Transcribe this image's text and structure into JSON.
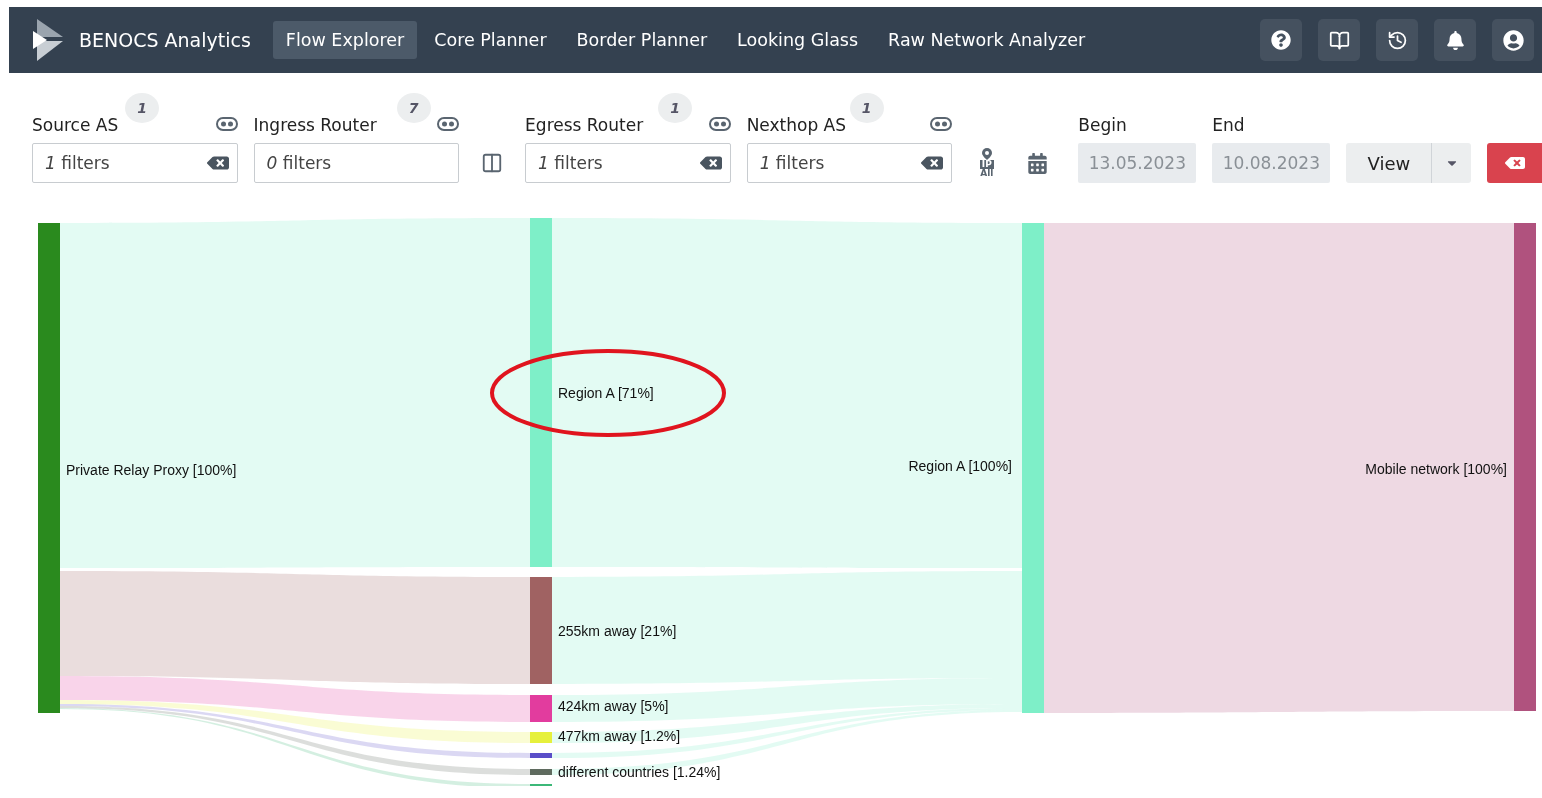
{
  "app": {
    "brand": "BENOCS Analytics"
  },
  "nav": [
    {
      "label": "Flow Explorer",
      "selected": true
    },
    {
      "label": "Core Planner",
      "selected": false
    },
    {
      "label": "Border Planner",
      "selected": false
    },
    {
      "label": "Looking Glass",
      "selected": false
    },
    {
      "label": "Raw Network Analyzer",
      "selected": false
    }
  ],
  "header_actions": [
    {
      "kind": "help"
    },
    {
      "kind": "docs"
    },
    {
      "kind": "history"
    },
    {
      "kind": "notifications"
    },
    {
      "kind": "account"
    }
  ],
  "filters": [
    {
      "label": "Source AS",
      "count": "1",
      "value": "*1* filters",
      "clearable": true
    },
    {
      "label": "Ingress Router",
      "count": "7",
      "value": "*0* filters",
      "clearable": false
    },
    {
      "label": "Egress Router",
      "count": "1",
      "value": "*1* filters",
      "clearable": true
    },
    {
      "label": "Nexthop AS",
      "count": "1",
      "value": "*1* filters",
      "clearable": true
    }
  ],
  "ip_scope": {
    "top": "IP",
    "bottom": "All"
  },
  "dates": [
    {
      "label": "Begin",
      "value": "13.05.2023",
      "disabled": true
    },
    {
      "label": "End",
      "value": "10.08.2023",
      "disabled": true
    }
  ],
  "view_button": {
    "label": "View"
  },
  "sankey": {
    "columns": [
      {
        "nodes": [
          {
            "label": "Private Relay Proxy [100%]",
            "color": "#2a8a1e",
            "highlighted": false
          }
        ]
      },
      {
        "nodes": [
          {
            "label": "Region A [71%]",
            "color": "#7eefc8",
            "highlighted": true
          },
          {
            "label": "255km away [21%]",
            "color": "#a06262",
            "highlighted": false
          },
          {
            "label": "424km away [5%]",
            "color": "#e23c9e",
            "highlighted": false
          },
          {
            "label": "477km away [1.2%]",
            "color": "#e6f03c",
            "highlighted": false
          },
          {
            "color": "#5a4ec8",
            "highlighted": false
          },
          {
            "label": "different countries [1.24%]",
            "color": "#5f6b5f",
            "highlighted": false
          },
          {
            "color": "#3cb878",
            "highlighted": false
          }
        ]
      },
      {
        "nodes": [
          {
            "label": "Region A [100%]",
            "color": "#7eefc8",
            "highlighted": false
          }
        ]
      },
      {
        "nodes": [
          {
            "label": "Mobile network [100%]",
            "color": "#b0527e",
            "highlighted": false
          }
        ]
      }
    ]
  }
}
